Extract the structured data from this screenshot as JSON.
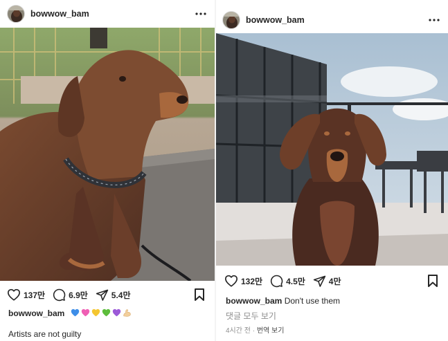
{
  "left_post": {
    "username": "bowwow_bam",
    "stats": {
      "likes": "137만",
      "comments": "6.9만",
      "shares": "5.4만"
    },
    "caption_username": "bowwow_bam",
    "emojis": [
      {
        "name": "blue-heart",
        "color": "#3e8ee8"
      },
      {
        "name": "pink-heart",
        "color": "#ef5fb4"
      },
      {
        "name": "yellow-heart",
        "color": "#f4c631"
      },
      {
        "name": "green-heart",
        "color": "#5dbd3c"
      },
      {
        "name": "purple-heart",
        "color": "#9c5ad8"
      },
      {
        "name": "flexed-biceps",
        "color": "#f2cf9c"
      }
    ],
    "caption_text": "Artists are not guilty"
  },
  "right_post": {
    "username": "bowwow_bam",
    "stats": {
      "likes": "132만",
      "comments": "4.5만",
      "shares": "4만"
    },
    "caption_username": "bowwow_bam",
    "caption_text": "Don't use them",
    "view_comments": "댓글 모두 보기",
    "time": "4시간 전",
    "separator": "·",
    "translate": "번역 보기"
  }
}
